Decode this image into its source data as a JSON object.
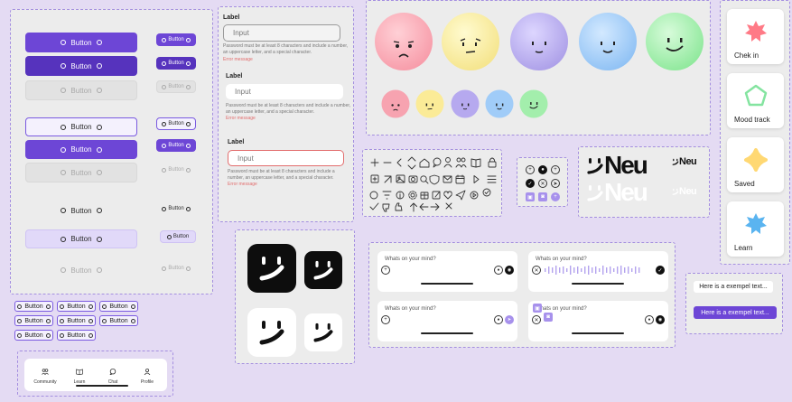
{
  "buttons": {
    "label": "Button"
  },
  "text_fields": {
    "label": "Label",
    "placeholder": "Input",
    "helper": "Password must be at least 8 characters and include a number, an uppercase letter, and a special character.",
    "error": "Error message"
  },
  "nav": {
    "items": [
      {
        "label": "Community",
        "icon": "community-icon"
      },
      {
        "label": "Learn",
        "icon": "book-icon"
      },
      {
        "label": "Chat",
        "icon": "chat-icon"
      },
      {
        "label": "Profile",
        "icon": "profile-icon"
      }
    ]
  },
  "brand": {
    "wordmark": "Neu"
  },
  "feature_cards": [
    {
      "label": "Chek in",
      "color": "#ff7a86",
      "shape": "star-burst-icon"
    },
    {
      "label": "Mood track",
      "color": "#84e4a0",
      "shape": "pentagon-icon"
    },
    {
      "label": "Saved",
      "color": "#ffd873",
      "shape": "cross-star-icon"
    },
    {
      "label": "Learn",
      "color": "#5ab4f0",
      "shape": "star-burst-icon"
    }
  ],
  "chat_inputs": {
    "placeholder": "Whats on your mind?"
  },
  "speech_bubbles": [
    {
      "text": "Here is a exempel text..."
    },
    {
      "text": "Here is a exempel text..."
    }
  ],
  "colors": {
    "background": "#e4dbf3",
    "primary": "#6d46d6",
    "face_pink": "#ffb3bd",
    "face_yellow": "#fff0a8",
    "face_purple": "#c2b6f2",
    "face_blue": "#a9d3fb",
    "face_green": "#aef0b4"
  }
}
